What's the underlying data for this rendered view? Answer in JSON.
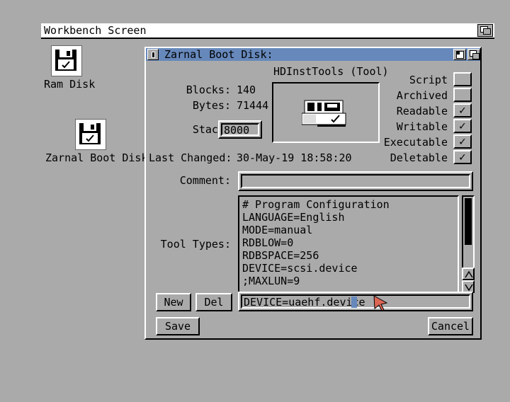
{
  "screen": {
    "title": "Workbench Screen"
  },
  "desktop": {
    "icons": [
      {
        "label": "Ram Disk"
      },
      {
        "label": "Zarnal Boot Disk"
      }
    ]
  },
  "window": {
    "title": "Zarnal Boot Disk:",
    "icon_title": "HDInstTools (Tool)",
    "blocks_label": "Blocks:",
    "blocks": "140",
    "bytes_label": "Bytes:",
    "bytes": "71444",
    "stack_label": "Stack:",
    "stack": "8000",
    "changed_label": "Last Changed:",
    "changed": "30-May-19 18:58:20",
    "comment_label": "Comment:",
    "comment": "",
    "tooltypes_label": "Tool Types:",
    "tooltypes": [
      "# Program Configuration",
      "LANGUAGE=English",
      "MODE=manual",
      "RDBLOW=0",
      "RDBSPACE=256",
      "DEVICE=scsi.device",
      ";MAXLUN=9"
    ],
    "edit_value": "DEVICE=uaehf.device",
    "new_label": "New",
    "del_label": "Del",
    "save_label": "Save",
    "cancel_label": "Cancel",
    "flags": [
      {
        "label": "Script",
        "checked": false
      },
      {
        "label": "Archived",
        "checked": false
      },
      {
        "label": "Readable",
        "checked": true
      },
      {
        "label": "Writable",
        "checked": true
      },
      {
        "label": "Executable",
        "checked": true
      },
      {
        "label": "Deletable",
        "checked": true
      }
    ],
    "check_mark": "✓"
  },
  "colors": {
    "background": "#aaaaaa",
    "title_active": "#6688bb",
    "cursor": "#dd6655"
  }
}
